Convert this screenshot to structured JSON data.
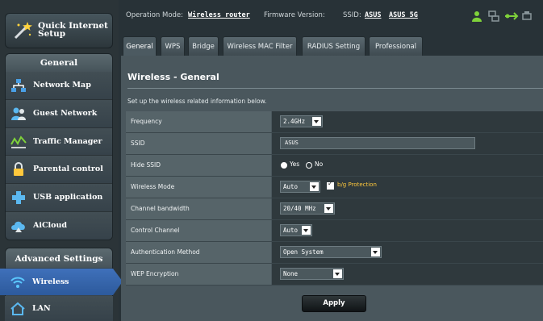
{
  "sidebar": {
    "quick_setup": "Quick Internet Setup",
    "general_header": "General",
    "general_items": [
      {
        "label": "Network Map",
        "icon": "network-map-icon"
      },
      {
        "label": "Guest Network",
        "icon": "guest-network-icon"
      },
      {
        "label": "Traffic Manager",
        "icon": "traffic-manager-icon"
      },
      {
        "label": "Parental control",
        "icon": "parental-control-icon"
      },
      {
        "label": "USB application",
        "icon": "usb-icon"
      },
      {
        "label": "AiCloud",
        "icon": "aicloud-icon"
      }
    ],
    "advanced_header": "Advanced Settings",
    "advanced_items": [
      {
        "label": "Wireless",
        "icon": "wireless-icon",
        "active": true
      },
      {
        "label": "LAN",
        "icon": "lan-icon"
      }
    ]
  },
  "topbar": {
    "op_mode_label": "Operation Mode:",
    "op_mode_value": "Wireless router",
    "firmware_label": "Firmware Version:",
    "ssid_label": "SSID:",
    "ssid_values": [
      "ASUS",
      "ASUS_5G"
    ]
  },
  "tabs": [
    "General",
    "WPS",
    "Bridge",
    "Wireless MAC Filter",
    "RADIUS Setting",
    "Professional"
  ],
  "active_tab": "General",
  "panel": {
    "title": "Wireless - General",
    "description": "Set up the wireless related information below.",
    "fields": {
      "frequency": {
        "label": "Frequency",
        "value": "2.4GHz"
      },
      "ssid": {
        "label": "SSID",
        "value": "ASUS"
      },
      "hide_ssid": {
        "label": "Hide SSID",
        "yes": "Yes",
        "no": "No",
        "selected": "Yes"
      },
      "wireless_mode": {
        "label": "Wireless Mode",
        "value": "Auto",
        "protection_label": "b/g Protection",
        "protection_checked": true
      },
      "channel_bandwidth": {
        "label": "Channel bandwidth",
        "value": "20/40 MHz"
      },
      "control_channel": {
        "label": "Control Channel",
        "value": "Auto"
      },
      "auth_method": {
        "label": "Authentication Method",
        "value": "Open System"
      },
      "wep_encryption": {
        "label": "WEP Encryption",
        "value": "None"
      }
    },
    "apply_label": "Apply"
  },
  "colors": {
    "accent_blue": "#3d6cb4",
    "protection_text": "#ffc83c",
    "status_green": "#7fd23a"
  }
}
